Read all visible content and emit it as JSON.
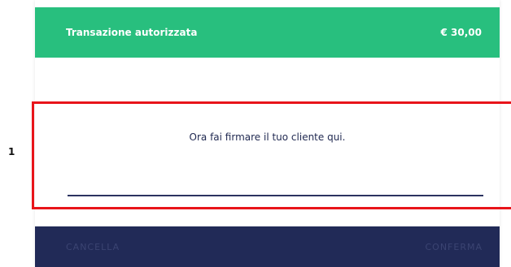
{
  "header": {
    "title": "Transazione autorizzata",
    "amount": "€ 30,00"
  },
  "signature": {
    "prompt": "Ora fai firmare il tuo cliente qui."
  },
  "footer": {
    "cancel_label": "CANCELLA",
    "confirm_label": "CONFERMA"
  },
  "annotation": {
    "marker_label": "1"
  },
  "colors": {
    "header_bg": "#28bf7e",
    "footer_bg": "#212a57",
    "footer_text": "#3b4472",
    "sign_line": "#2b3360",
    "highlight_border": "#e8141a"
  }
}
